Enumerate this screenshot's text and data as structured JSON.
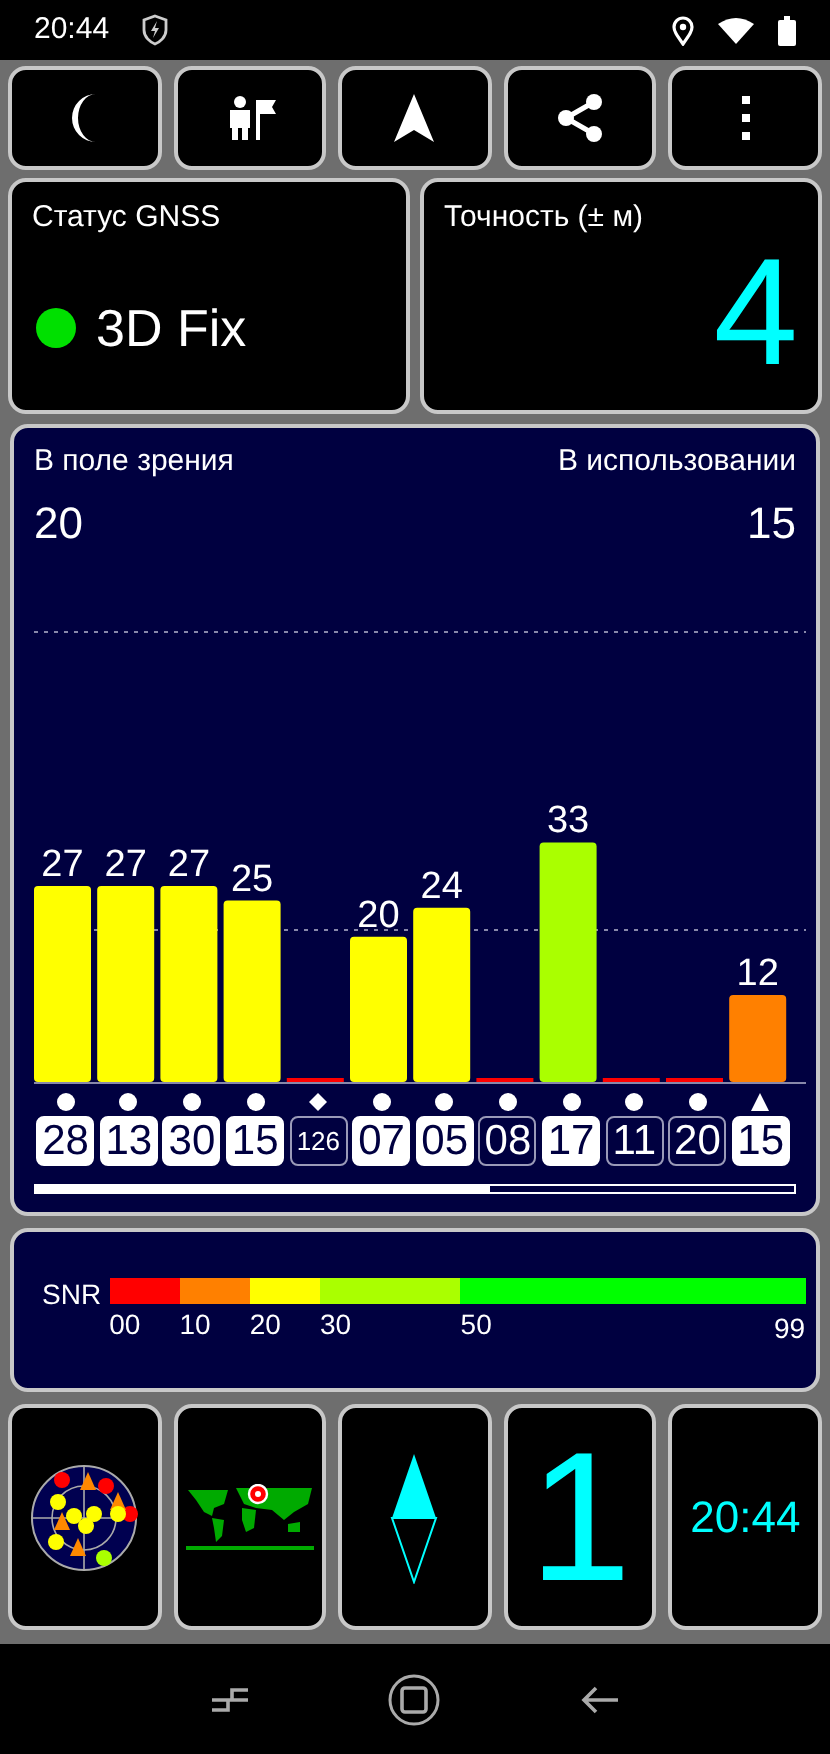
{
  "status_bar": {
    "time": "20:44"
  },
  "gnss_status": {
    "title": "Статус GNSS",
    "fix": "3D Fix",
    "color": "#00e000"
  },
  "accuracy": {
    "title": "Точность (± м)",
    "value": "4"
  },
  "satellites_panel": {
    "in_view_label": "В поле зрения",
    "in_view": "20",
    "in_use_label": "В использовании",
    "in_use": "15",
    "chart_data": {
      "type": "bar",
      "categories": [
        "28",
        "13",
        "30",
        "15",
        "126",
        "07",
        "05",
        "08",
        "17",
        "11",
        "20",
        "15"
      ],
      "values": [
        27,
        27,
        27,
        25,
        0,
        20,
        24,
        0,
        33,
        0,
        0,
        12
      ],
      "value_labels": [
        "27",
        "27",
        "27",
        "25",
        null,
        "20",
        "24",
        null,
        "33",
        null,
        null,
        "12"
      ]
    },
    "satellites": [
      {
        "kind": "circle",
        "used": true
      },
      {
        "kind": "circle",
        "used": true
      },
      {
        "kind": "circle",
        "used": true
      },
      {
        "kind": "circle",
        "used": true
      },
      {
        "kind": "diamond",
        "used": false
      },
      {
        "kind": "circle",
        "used": true
      },
      {
        "kind": "circle",
        "used": true
      },
      {
        "kind": "circle",
        "used": false
      },
      {
        "kind": "circle",
        "used": true
      },
      {
        "kind": "circle",
        "used": false
      },
      {
        "kind": "circle",
        "used": false
      },
      {
        "kind": "triangle",
        "used": true
      }
    ]
  },
  "snr_legend": {
    "label": "SNR",
    "segments": [
      {
        "label": "00",
        "color": "#ff0000"
      },
      {
        "label": "10",
        "color": "#ff8000"
      },
      {
        "label": "20",
        "color": "#ffff00"
      },
      {
        "label": "30",
        "color": "#aaff00"
      },
      {
        "label": "50",
        "color": "#00ff00"
      }
    ],
    "end_label": "99"
  },
  "tiles": {
    "satellites_count": "1",
    "clock": "20:44"
  }
}
